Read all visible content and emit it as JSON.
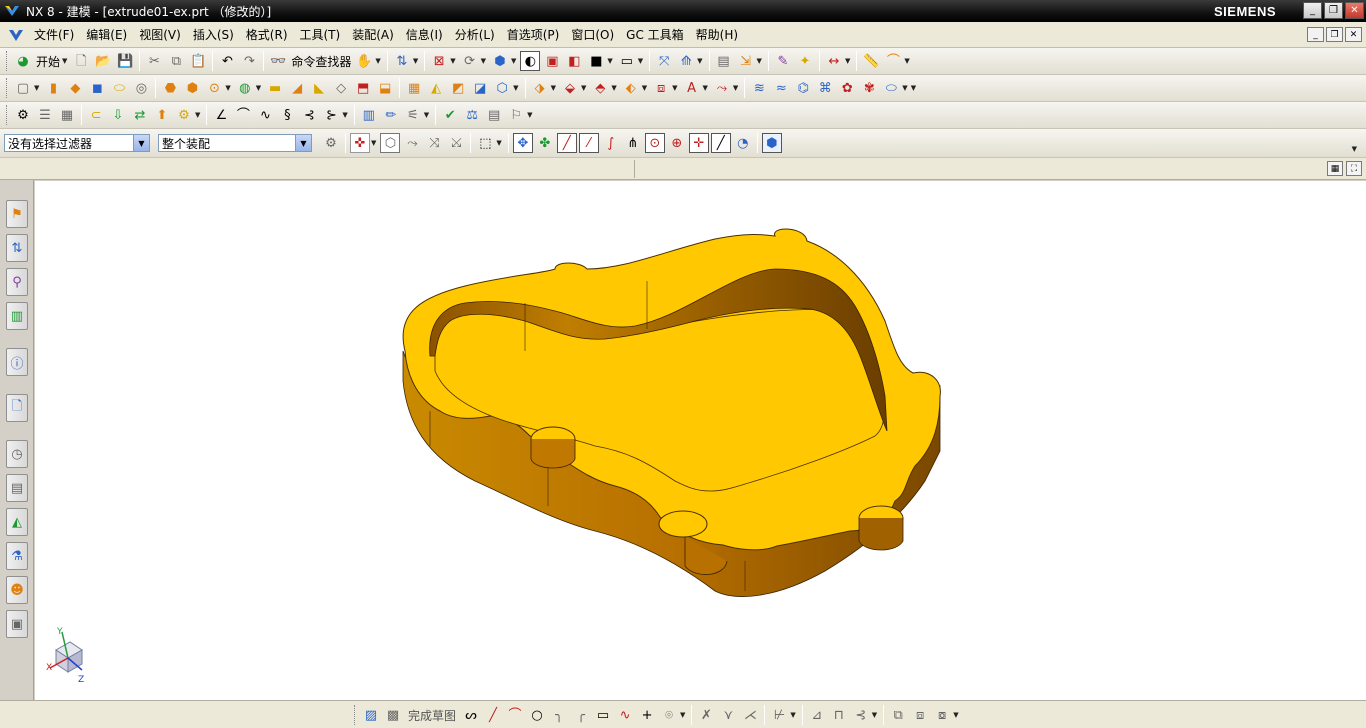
{
  "window": {
    "title": "NX 8 - 建模 - [extrude01-ex.prt （修改的）]",
    "brand": "SIEMENS",
    "buttons": [
      "_",
      "❐",
      "✕"
    ]
  },
  "menubar": {
    "items": [
      "文件(F)",
      "编辑(E)",
      "视图(V)",
      "插入(S)",
      "格式(R)",
      "工具(T)",
      "装配(A)",
      "信息(I)",
      "分析(L)",
      "首选项(P)",
      "窗口(O)",
      "GC 工具箱",
      "帮助(H)"
    ],
    "mdi_buttons": [
      "_",
      "❐",
      "✕"
    ]
  },
  "toolbar1": {
    "start_label": "开始",
    "command_finder_label": "命令查找器"
  },
  "selection_bar": {
    "filter_value": "没有选择过滤器",
    "scope_value": "整个装配"
  },
  "bottom_toolbar": {
    "finish_sketch_label": "完成草图"
  },
  "triad": {
    "x_label": "X",
    "y_label": "Y",
    "z_label": "Z"
  },
  "colors": {
    "part_face": "#ffc800",
    "part_side": "#b87800",
    "part_dark": "#7a4a00",
    "titlebar": "#000000",
    "background": "#ffffff"
  },
  "icons": {
    "resource_bar": [
      "assembly-navigator-icon",
      "constraint-navigator-icon",
      "part-navigator-icon",
      "reuse-library-icon",
      "hd3d-tools-icon",
      "web-browser-icon",
      "history-icon",
      "process-studio-icon",
      "visualization-icon",
      "roles-icon",
      "system-materials-icon",
      "template-icon"
    ]
  }
}
